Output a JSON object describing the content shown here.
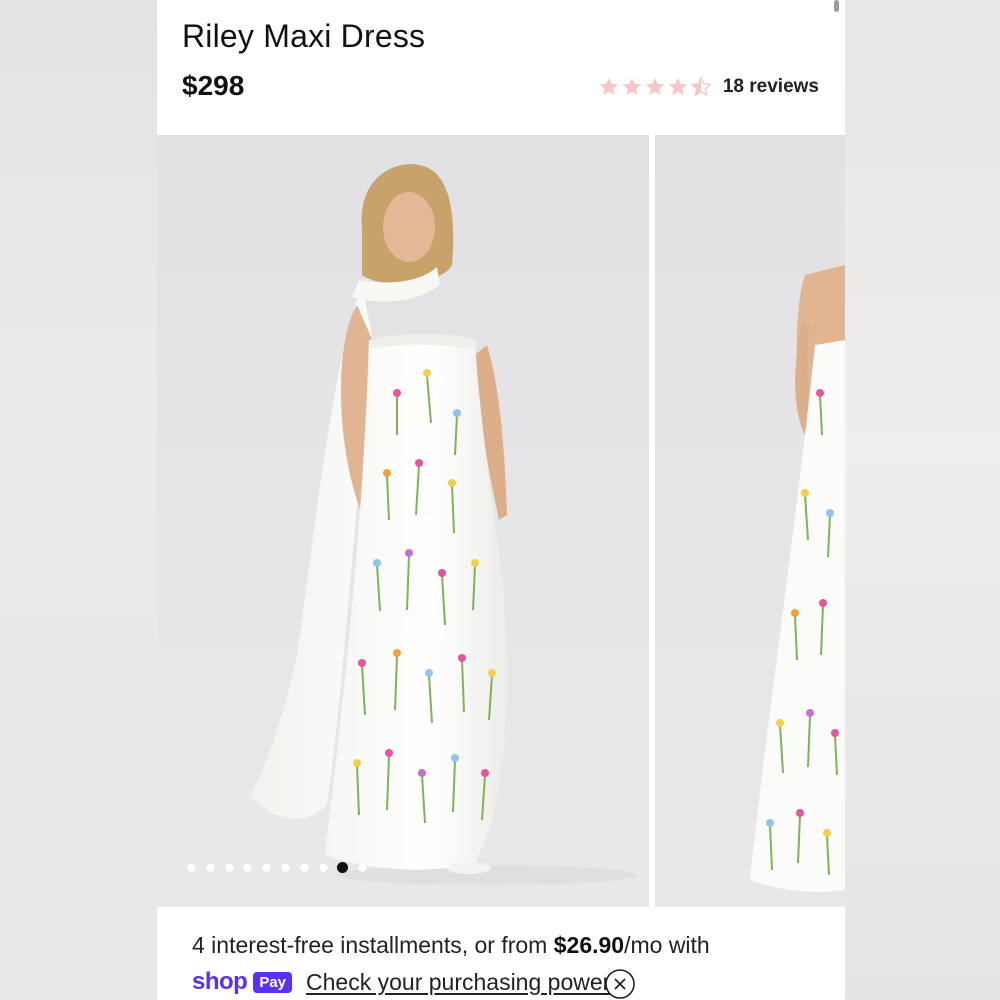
{
  "product": {
    "title": "Riley Maxi Dress",
    "price": "$298",
    "rating": 4.5,
    "rating_max": 5,
    "reviews_label": "18 reviews"
  },
  "gallery": {
    "image_count": 10,
    "active_index": 8,
    "slides": [
      {
        "icon": "model-front-photo"
      },
      {
        "icon": "model-back-photo"
      }
    ]
  },
  "payment": {
    "prefix": "4 interest-free installments, or from ",
    "amount": "$26.90",
    "suffix": "/mo with",
    "brand_shop": "shop",
    "brand_pay": "Pay",
    "link_label": "Check your purchasing power"
  },
  "colors": {
    "star": "#f7c6c6",
    "shop_pay": "#5a31f4",
    "dot_active": "#111111"
  }
}
